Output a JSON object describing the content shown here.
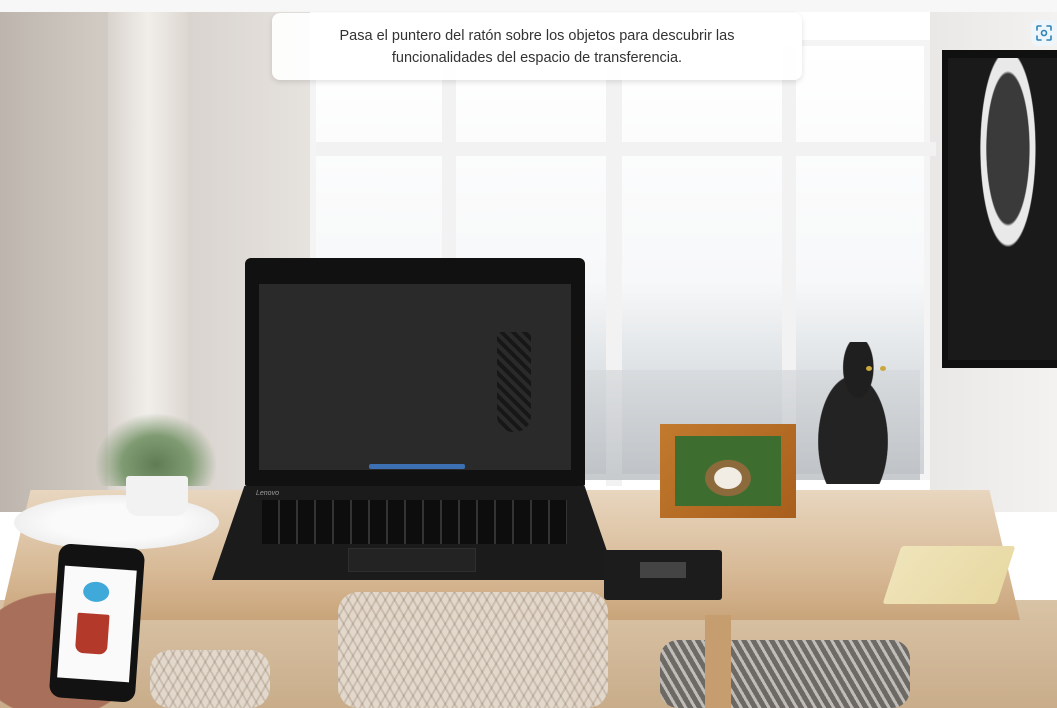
{
  "instruction_box": {
    "text": "Pasa el puntero del ratón sobre los objetos para descubrir las funcionalidades del espacio de transferencia."
  },
  "laptop": {
    "brand": "Lenovo"
  },
  "fullscreen_button": {
    "icon": "fullscreen-icon"
  },
  "scene_objects": [
    "laptop",
    "phone",
    "picture-frame",
    "cat",
    "poster",
    "vhs-tape",
    "notebook",
    "plant"
  ],
  "colors": {
    "accent": "#3d9fd0",
    "frame": "#b86d27",
    "mug": "#b33a2b"
  }
}
